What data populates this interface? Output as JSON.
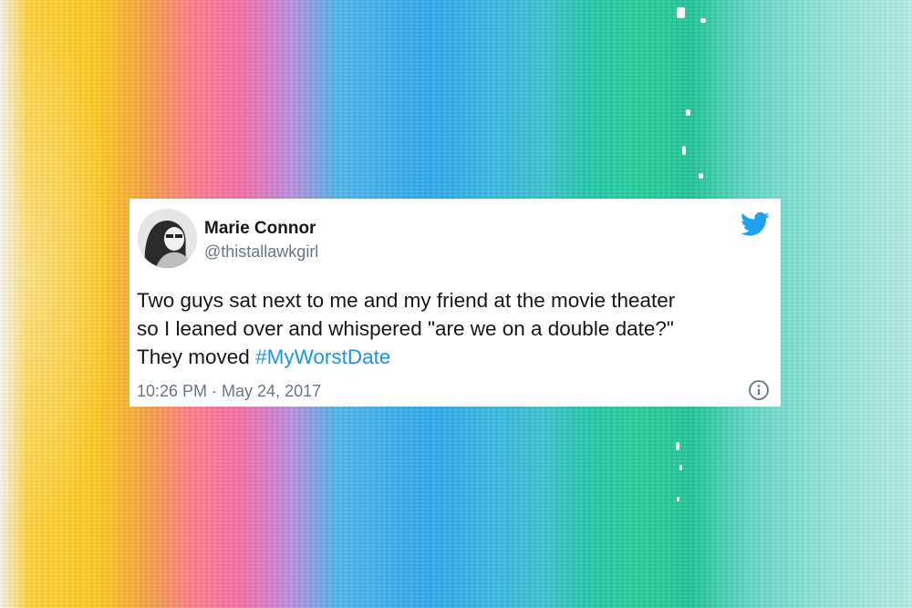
{
  "tweet": {
    "author_name": "Marie Connor",
    "handle": "@thistallawkgirl",
    "text": "Two guys sat next to me and my friend at the movie theater\nso I leaned over and whispered \"are we on a double date?\"\nThey moved ",
    "hashtag": "#MyWorstDate",
    "timestamp": "10:26 PM · May 24, 2017",
    "icons": [
      "avatar",
      "twitter-bird-icon",
      "info-icon"
    ],
    "colors": {
      "brand_blue": "#1da1f2",
      "hashtag_blue": "#1b95e0",
      "text": "#14171a",
      "muted": "#657786"
    }
  }
}
